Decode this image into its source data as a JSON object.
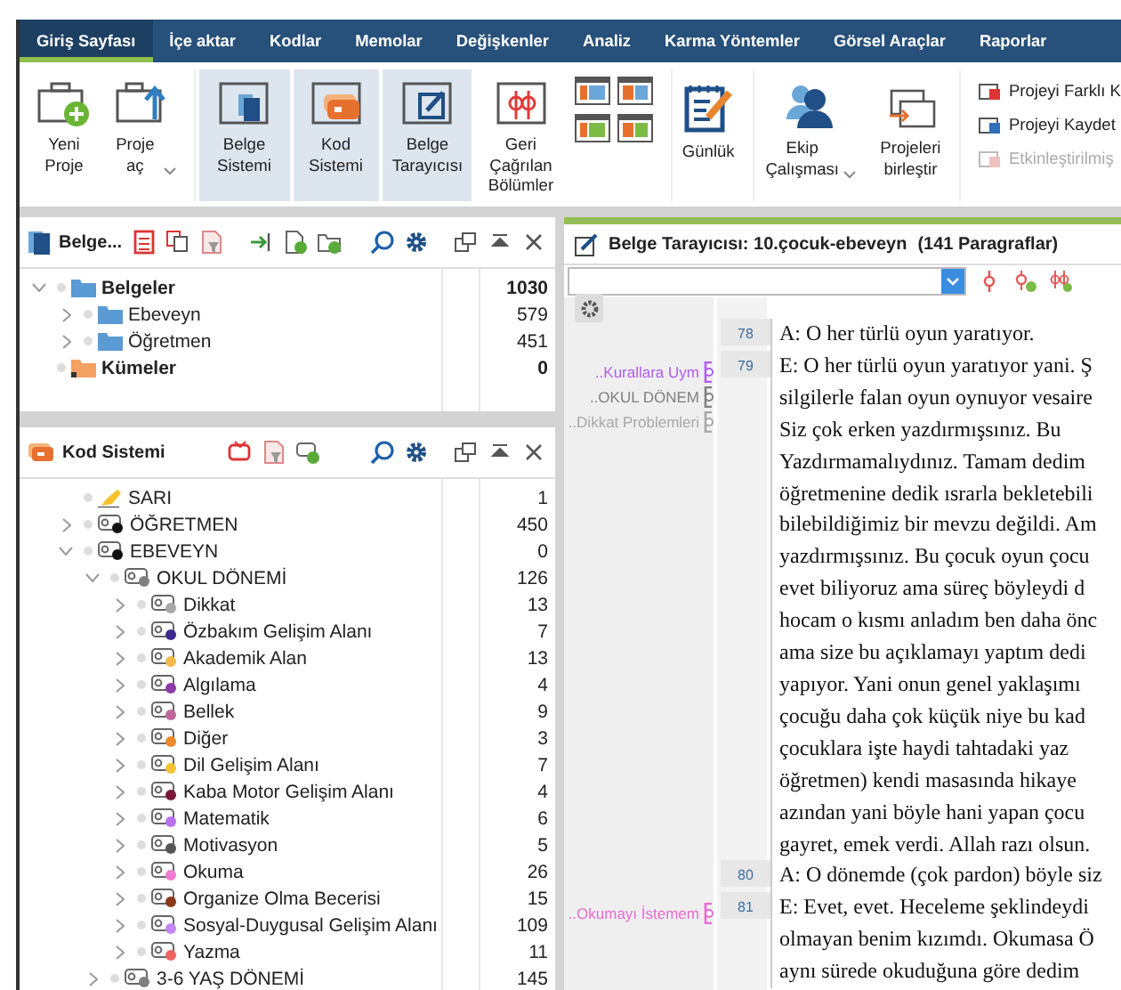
{
  "tabs": [
    {
      "label": "Giriş Sayfası",
      "selected": true
    },
    {
      "label": "İçe aktar",
      "selected": false
    },
    {
      "label": "Kodlar",
      "selected": false
    },
    {
      "label": "Memolar",
      "selected": false
    },
    {
      "label": "Değişkenler",
      "selected": false
    },
    {
      "label": "Analiz",
      "selected": false
    },
    {
      "label": "Karma Yöntemler",
      "selected": false
    },
    {
      "label": "Görsel Araçlar",
      "selected": false
    },
    {
      "label": "Raporlar",
      "selected": false
    }
  ],
  "ribbon": {
    "buttons": [
      {
        "kind": "new",
        "label": "Yeni Proje",
        "selected": false,
        "dropdown": false
      },
      {
        "kind": "open",
        "label": "Proje aç",
        "selected": false,
        "dropdown": true
      },
      {
        "kind": "documents",
        "label": "Belge Sistemi",
        "selected": true,
        "dropdown": false
      },
      {
        "kind": "codes",
        "label": "Kod Sistemi",
        "selected": true,
        "dropdown": false
      },
      {
        "kind": "browser",
        "label": "Belge Tarayıcısı",
        "selected": true,
        "dropdown": false
      },
      {
        "kind": "segments",
        "label": "Geri Çağrılan Bölümler",
        "selected": false,
        "dropdown": false
      },
      {
        "kind": "layouts",
        "selected": false,
        "dropdown": false
      },
      {
        "kind": "journal",
        "label": "Günlük",
        "selected": false,
        "dropdown": false
      },
      {
        "kind": "team",
        "label": "Ekip Çalışması",
        "selected": false,
        "dropdown": true
      },
      {
        "kind": "merge",
        "label": "Projeleri birleştir",
        "selected": false,
        "dropdown": false
      }
    ],
    "commands": [
      {
        "label": "Projeyi Farklı K",
        "disabled": false
      },
      {
        "label": "Projeyi Kaydet",
        "disabled": false
      },
      {
        "label": "Etkinleştirilmiş",
        "disabled": true
      }
    ]
  },
  "documents_panel": {
    "title": "Belge...",
    "items": [
      {
        "kind": "folder",
        "name": "Belgeler",
        "count": "1030",
        "bold": true,
        "expanded": true,
        "children": [
          {
            "kind": "folder",
            "name": "Ebeveyn",
            "count": "579",
            "bold": false,
            "expanded": false
          },
          {
            "kind": "folder",
            "name": "Öğretmen",
            "count": "451",
            "bold": false,
            "expanded": false
          }
        ]
      },
      {
        "kind": "set",
        "name": "Kümeler",
        "count": "0",
        "bold": true
      }
    ]
  },
  "code_panel": {
    "title": "Kod Sistemi",
    "items": [
      {
        "kind": "highlight",
        "name": "SARI",
        "count": "1"
      },
      {
        "kind": "code",
        "name": "ÖĞRETMEN",
        "count": "450",
        "color": "#111111",
        "expanded": false
      },
      {
        "kind": "code",
        "name": "EBEVEYN",
        "count": "0",
        "color": "#111111",
        "expanded": true,
        "children": [
          {
            "kind": "code",
            "name": "OKUL DÖNEMİ",
            "count": "126",
            "color": "#808080",
            "expanded": true,
            "children": [
              {
                "kind": "code",
                "name": "Dikkat",
                "count": "13",
                "color": "#a8a8a8",
                "expanded": false
              },
              {
                "kind": "code",
                "name": "Özbakım Gelişim Alanı",
                "count": "7",
                "color": "#3b2a8c",
                "expanded": false
              },
              {
                "kind": "code",
                "name": "Akademik Alan",
                "count": "13",
                "color": "#f3b94c",
                "expanded": false
              },
              {
                "kind": "code",
                "name": "Algılama",
                "count": "4",
                "color": "#8e3aa8",
                "expanded": false
              },
              {
                "kind": "code",
                "name": "Bellek",
                "count": "9",
                "color": "#c2679c",
                "expanded": false
              },
              {
                "kind": "code",
                "name": "Diğer",
                "count": "3",
                "color": "#ee8a2e",
                "expanded": false
              },
              {
                "kind": "code",
                "name": "Dil Gelişim Alanı",
                "count": "7",
                "color": "#f2c232",
                "expanded": false
              },
              {
                "kind": "code",
                "name": "Kaba Motor Gelişim Alanı",
                "count": "4",
                "color": "#7a1838",
                "expanded": false
              },
              {
                "kind": "code",
                "name": "Matematik",
                "count": "6",
                "color": "#b872f2",
                "expanded": false
              },
              {
                "kind": "code",
                "name": "Motivasyon",
                "count": "5",
                "color": "#555555",
                "expanded": false
              },
              {
                "kind": "code",
                "name": "Okuma",
                "count": "26",
                "color": "#f07ad2",
                "expanded": false
              },
              {
                "kind": "code",
                "name": "Organize Olma Becerisi",
                "count": "15",
                "color": "#8a3a18",
                "expanded": false
              },
              {
                "kind": "code",
                "name": "Sosyal-Duygusal Gelişim Alanı",
                "count": "109",
                "color": "#c486f2",
                "expanded": false
              },
              {
                "kind": "code",
                "name": "Yazma",
                "count": "11",
                "color": "#f06262",
                "expanded": false
              }
            ]
          },
          {
            "kind": "code",
            "name": "3-6 YAŞ DÖNEMİ",
            "count": "145",
            "color": "#808080",
            "expanded": false
          }
        ]
      }
    ]
  },
  "browser": {
    "title": "Belge Tarayıcısı: 10.çocuk-ebeveyn",
    "subtitle": "(141 Paragraflar)",
    "paragraphs": [
      {
        "number": "78",
        "lines": [
          "A: O her türlü oyun yaratıyor."
        ]
      },
      {
        "number": "79",
        "codes": [
          {
            "label": "..Kurallara Uym",
            "color": "#b05cf0"
          },
          {
            "label": "..OKUL DÖNEM",
            "color": "#808080"
          },
          {
            "label": "..Dikkat Problemleri",
            "color": "#a8a8a8"
          }
        ],
        "lines": [
          "E: O her türlü oyun yaratıyor yani. Ş",
          "silgilerle falan oyun oynuyor vesaire",
          "Siz çok erken yazdırmışsınız. Bu",
          "Yazdırmamalıydınız. Tamam dedim",
          "öğretmenine dedik ısrarla bekletebili",
          "bilebildiğimiz bir mevzu değildi. Am",
          "yazdırmışsınız. Bu çocuk oyun çocu",
          "evet biliyoruz ama süreç böyleydi d",
          "hocam o kısmı anladım ben daha önc",
          "ama size bu açıklamayı yaptım dedi",
          "yapıyor. Yani onun genel yaklaşımı",
          "çocuğu daha çok küçük niye bu kad",
          "çocuklara işte haydi tahtadaki yaz",
          "öğretmen) kendi masasında hikaye",
          "azından yani böyle hani yapan çocu",
          "gayret, emek verdi. Allah razı olsun."
        ]
      },
      {
        "number": "80",
        "lines": [
          "A: O dönemde (çok pardon) böyle siz"
        ]
      },
      {
        "number": "81",
        "codes": [
          {
            "label": "..Okumayı İstemem",
            "color": "#e86ad0"
          }
        ],
        "lines": [
          "E: Evet, evet. Heceleme şeklindeydi",
          "olmayan benim kızımdı. Okumasa Ö",
          "aynı sürede okuduğuna göre dedim"
        ]
      }
    ]
  }
}
